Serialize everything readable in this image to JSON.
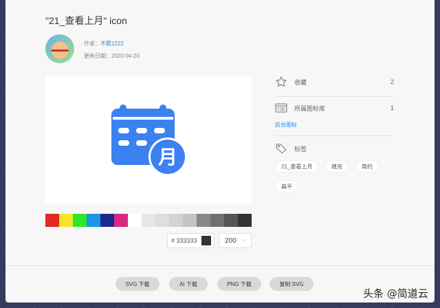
{
  "page_title": "\"21_查看上月\" icon",
  "meta": {
    "author_prefix": "作者：",
    "author_name": "不羁1222",
    "updated_label": "更新日期：",
    "updated_date": "2020-04-20"
  },
  "icon": {
    "name": "calendar-month-icon",
    "glyph_text": "月",
    "color": "#3b82f0"
  },
  "palette": [
    "#e02b20",
    "#f7e329",
    "#2ee82a",
    "#1996e6",
    "#1b2a8c",
    "#d62a84",
    "#ffffff",
    "#e6e6e6",
    "#dedede",
    "#d2d2d2",
    "#c4c4c4",
    "#888888",
    "#707070",
    "#555555",
    "#333333"
  ],
  "color_picker": {
    "hash": "#",
    "value": "333333",
    "chip_color": "#333333"
  },
  "size_select": {
    "value": "200"
  },
  "sidebar": {
    "favorite": {
      "label": "收藏",
      "count": "2"
    },
    "library": {
      "label": "所属图标库",
      "count": "1",
      "link": "后台图标"
    },
    "tags_label": "标签",
    "tags": [
      "21_查看上月",
      "填充",
      "简约",
      "扁平"
    ]
  },
  "buttons": {
    "svg_download": "SVG 下载",
    "ai_download": "AI 下载",
    "png_download": "PNG 下载",
    "copy_svg": "复制 SVG"
  },
  "watermark": "头条 @简道云"
}
